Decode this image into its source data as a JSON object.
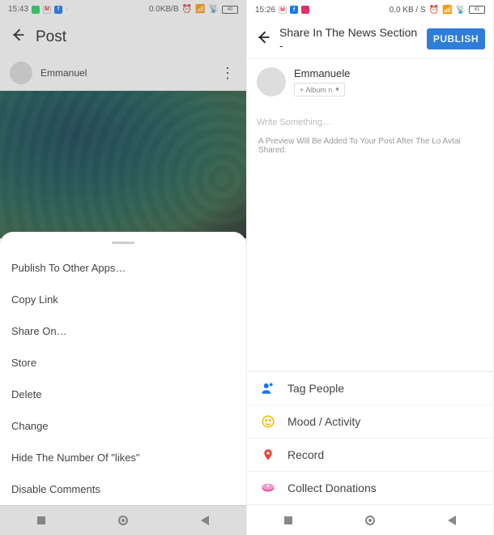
{
  "left": {
    "status": {
      "time": "15:43",
      "net": "0.0KB/B",
      "battery": "40"
    },
    "header": {
      "title": "Post"
    },
    "user": {
      "name": "Emmanuel"
    },
    "menu": {
      "publish_other": "Publish To Other Apps…",
      "copy_link": "Copy Link",
      "share_on": "Share On…",
      "store": "Store",
      "delete": "Delete",
      "change": "Change",
      "hide_likes": "Hide The Number Of \"likes\"",
      "disable_comments": "Disable Comments"
    }
  },
  "right": {
    "status": {
      "time": "15:26",
      "net": "0.0 KB / S",
      "battery": "41"
    },
    "header": {
      "title": "Share In The News Section -",
      "publish": "PUBLISH"
    },
    "user": {
      "name": "Emmanuele",
      "album": "+ Album n"
    },
    "composer": {
      "placeholder": "Write Something…"
    },
    "preview_note": "A Preview Will Be Added To Your Post After The Lo Avtai Shared.",
    "actions": {
      "tag": "Tag People",
      "mood": "Mood / Activity",
      "record": "Record",
      "donate": "Collect Donations"
    }
  }
}
